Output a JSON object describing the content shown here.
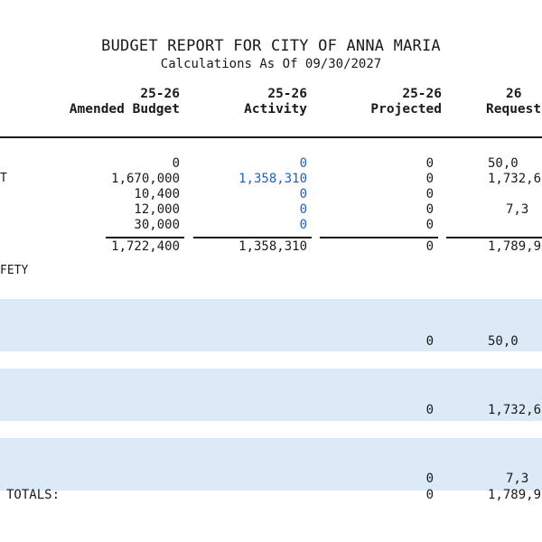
{
  "report": {
    "title": "BUDGET REPORT FOR CITY OF ANNA MARIA",
    "subtitle": "Calculations As Of 09/30/2027"
  },
  "columns": [
    {
      "year": "25-26",
      "label": "Amended Budget"
    },
    {
      "year": "25-26",
      "label": "Activity"
    },
    {
      "year": "25-26",
      "label": "Projected"
    },
    {
      "year": "26",
      "label": "Request"
    }
  ],
  "line_items": [
    {
      "label": "",
      "amended": "0",
      "activity": "0",
      "projected": "0",
      "request": "50,0"
    },
    {
      "label": "T",
      "amended": "1,670,000",
      "activity": "1,358,310",
      "projected": "0",
      "request": "1,732,6"
    },
    {
      "label": "",
      "amended": "10,400",
      "activity": "0",
      "projected": "0",
      "request": ""
    },
    {
      "label": "",
      "amended": "12,000",
      "activity": "0",
      "projected": "0",
      "request": "7,3"
    },
    {
      "label": "",
      "amended": "30,000",
      "activity": "0",
      "projected": "0",
      "request": ""
    }
  ],
  "subtotal": {
    "amended": "1,722,400",
    "activity": "1,358,310",
    "projected": "0",
    "request": "1,789,9"
  },
  "section_label": "FETY",
  "summary_rows": [
    {
      "projected": "0",
      "request": "50,0"
    },
    {
      "projected": "0",
      "request": "1,732,6"
    },
    {
      "projected": "0",
      "request": "7,3"
    }
  ],
  "totals": {
    "label": "TOTALS:",
    "projected": "0",
    "request": "1,789,9"
  }
}
